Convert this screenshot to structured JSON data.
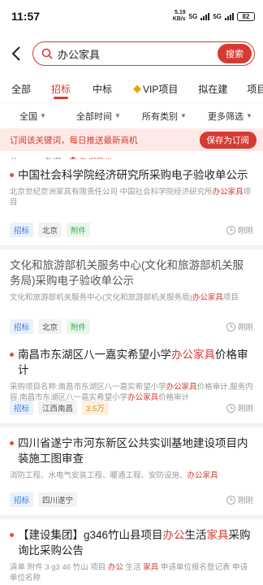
{
  "status": {
    "time": "11:57",
    "speed_value": "5.19",
    "speed_unit": "KB/s",
    "net1": "5G",
    "net2": "5G",
    "battery": "82"
  },
  "search": {
    "query": "办公家具",
    "button_label": "搜索"
  },
  "tabs": [
    {
      "label": "全部"
    },
    {
      "label": "招标"
    },
    {
      "label": "中标"
    },
    {
      "label": "VIP项目"
    },
    {
      "label": "拟在建"
    },
    {
      "label": "项目"
    }
  ],
  "filters": [
    {
      "label": "全国"
    },
    {
      "label": "全部时间"
    },
    {
      "label": "所有类别"
    },
    {
      "label": "更多筛选"
    }
  ],
  "subscribe": {
    "text": "订阅该关键词，每日推送最新商机",
    "button_label": "保存为订阅"
  },
  "results": {
    "count_prefix": "共",
    "count": "55860",
    "count_suffix": "数据",
    "export_label": "数据导出"
  },
  "cards": [
    {
      "title": "中国社会科学院经济研究所采购电子验收单公示",
      "desc_a": "北京世纪京洲家具有限责任公司 中国社会科学院经济研究所",
      "desc_hl": "办公家具",
      "desc_b": "项目",
      "tags": [
        "招标",
        "北京",
        "附件"
      ],
      "time": "刚刚"
    },
    {
      "title": "文化和旅游部机关服务中心(文化和旅游部机关服务局)采购电子验收单公示",
      "desc_a": "文化和旅游部机关服务中心(文化和旅游部机关服务局)",
      "desc_hl": "办公家具",
      "desc_b": "项目",
      "tags": [
        "招标",
        "北京",
        "附件"
      ],
      "time": "刚刚"
    },
    {
      "title_a": "南昌市东湖区八一嘉实希望小学",
      "title_hl": "办公家具",
      "title_b": "价格审计",
      "desc_a": "采购项目名称:南昌市东湖区八一嘉实希望小学",
      "desc_hl": "办公家具",
      "desc_b": "价格审计,服务内容:南昌市东湖区八一嘉实希望小学",
      "desc_hl2": "办公家具",
      "desc_c": "价格审计",
      "tags": [
        "招标",
        "江西南昌",
        "3.5万"
      ],
      "time": "刚刚"
    },
    {
      "title": "四川省遂宁市河东新区公共实训基地建设项目内装施工图审查",
      "desc_a": "消防工程、水电气安装工程、暖通工程、安防设施、",
      "desc_hl": "办公家具",
      "tags": [
        "招标",
        "四川遂宁"
      ],
      "time": "刚刚"
    },
    {
      "title_a": "【建设集团】g346竹山县项目",
      "title_hl": "办公",
      "title_b": "生活",
      "title_hl2": "家具",
      "title_c": "采购询比采购公告",
      "desc_a": "清单 附件 3 g3 46 竹山 项目 ",
      "desc_hl": "办公",
      "desc_b": " 生活 ",
      "desc_hl2": "家具",
      "desc_c": " 申请单位报名登记表 申请单位名称"
    }
  ],
  "colors": {
    "accent": "#d43c33",
    "tag_blue": "#3b7bd9",
    "tag_green": "#3aa64e",
    "tag_orange": "#e4891c"
  }
}
